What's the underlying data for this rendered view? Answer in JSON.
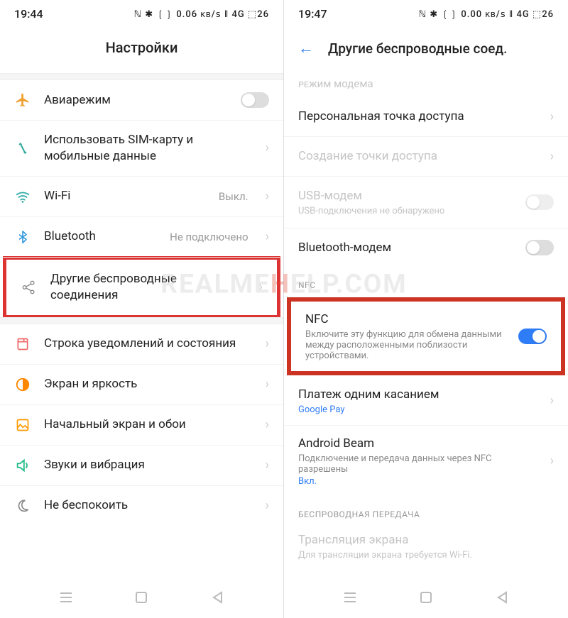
{
  "watermark": {
    "pre": "REALME",
    "h": "H",
    "post": "ELP.COM"
  },
  "left": {
    "time": "19:44",
    "status_icons": "ℕ ✱ ❲❳ 0.06 ᴋʙ/ꜱ ‖ 4G ⬚26",
    "title": "Настройки",
    "rows": {
      "airplane": {
        "label": "Авиарежим"
      },
      "sim": {
        "label": "Использовать SIM-карту и мобильные данные"
      },
      "wifi": {
        "label": "Wi-Fi",
        "value": "Выкл."
      },
      "bluetooth": {
        "label": "Bluetooth",
        "value": "Не подключено"
      },
      "other_wireless": {
        "label": "Другие беспроводные соединения"
      },
      "notifications": {
        "label": "Строка уведомлений и состояния"
      },
      "display": {
        "label": "Экран и яркость"
      },
      "home": {
        "label": "Начальный экран и обои"
      },
      "sound": {
        "label": "Звуки и вибрация"
      },
      "dnd": {
        "label": "Не беспокоить"
      }
    }
  },
  "right": {
    "time": "19:47",
    "status_icons": "ℕ ✱ ❲❳ 0.00 ᴋʙ/ꜱ ‖ 4G ⬚26",
    "title": "Другие беспроводные соед.",
    "cutoff_top": "ᴘᴇжим модема",
    "rows": {
      "hotspot": {
        "label": "Персональная точка доступа"
      },
      "create_hotspot": {
        "label": "Создание точки доступа"
      },
      "usb": {
        "label": "USB-модем",
        "sub": "USB-подключения не обнаружено"
      },
      "bt_modem": {
        "label": "Bluetooth-модем"
      },
      "nfc_section": "NFC",
      "nfc": {
        "label": "NFC",
        "sub": "Включите эту функцию для обмена данными между расположенными поблизости устройствами."
      },
      "pay": {
        "label": "Платеж одним касанием",
        "sub": "Google Pay"
      },
      "beam": {
        "label": "Android Beam",
        "sub": "Подключение и передача данных через NFC разрешены",
        "extra": "Вкл."
      },
      "cast_section": "БЕСПРОВОДНАЯ ПЕРЕДАЧА",
      "cast": {
        "label": "Трансляция экрана",
        "sub": "Для трансляции экрана требуется Wi-Fi."
      }
    }
  }
}
